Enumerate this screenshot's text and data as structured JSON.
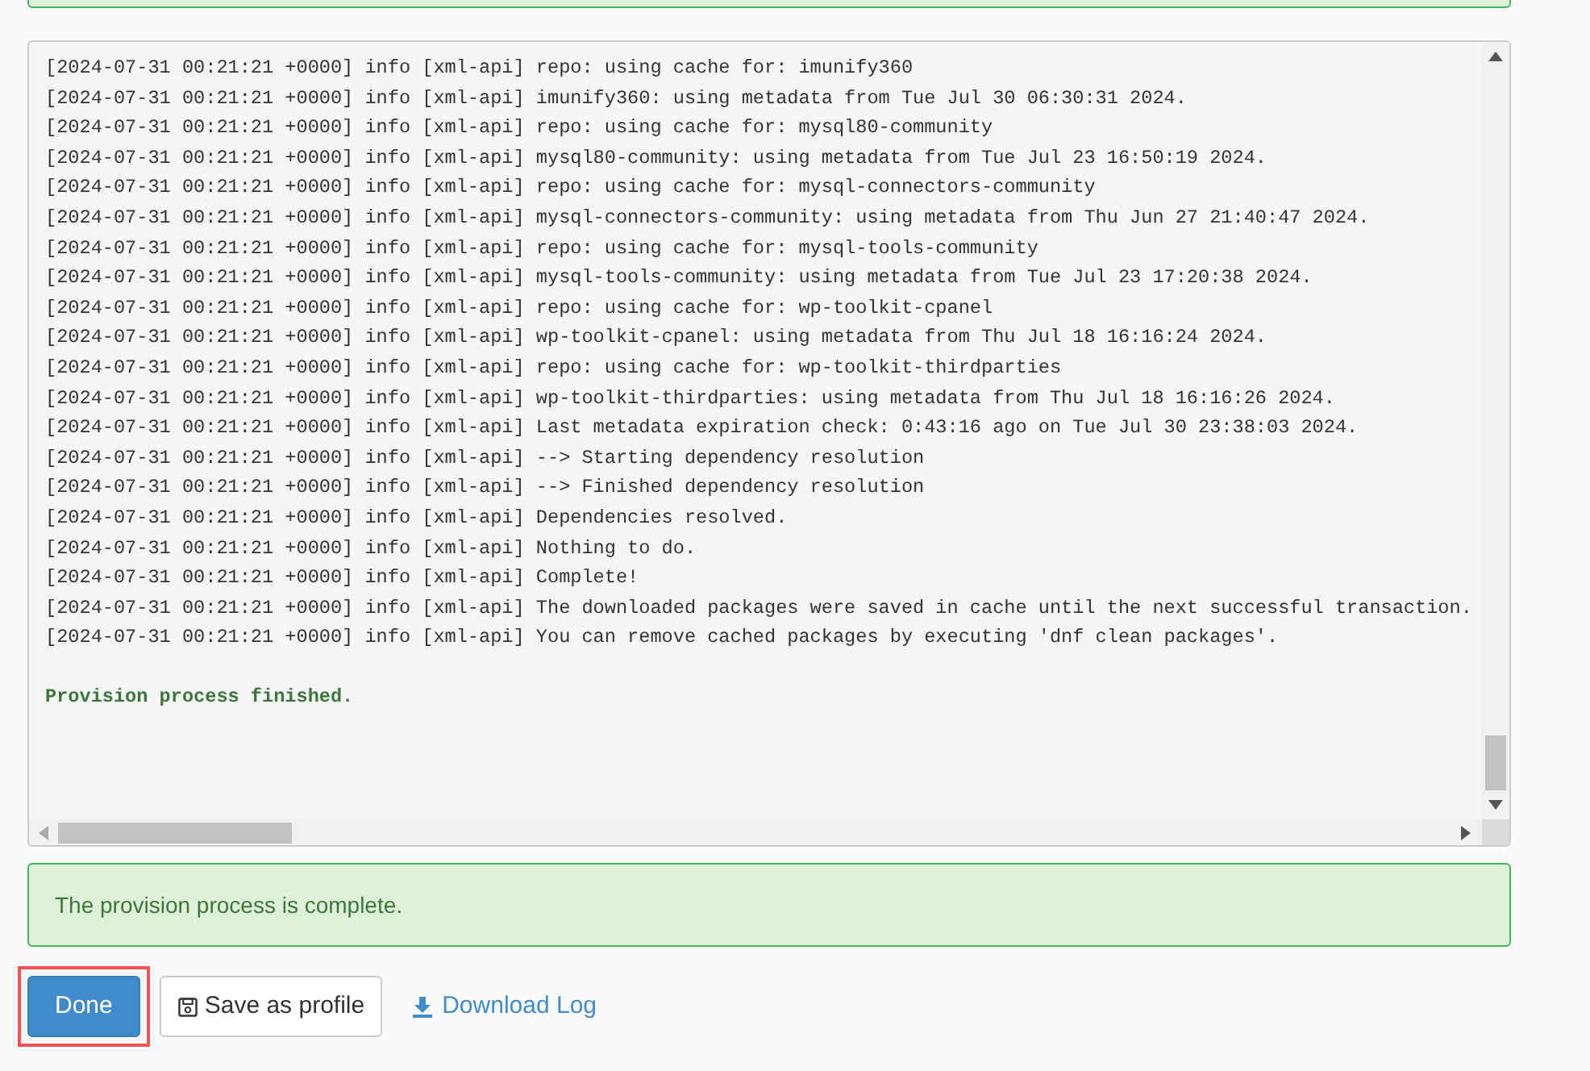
{
  "log": {
    "lines": [
      "[2024-07-31 00:21:21 +0000] info [xml-api] repo: using cache for: imunify360",
      "[2024-07-31 00:21:21 +0000] info [xml-api] imunify360: using metadata from Tue Jul 30 06:30:31 2024.",
      "[2024-07-31 00:21:21 +0000] info [xml-api] repo: using cache for: mysql80-community",
      "[2024-07-31 00:21:21 +0000] info [xml-api] mysql80-community: using metadata from Tue Jul 23 16:50:19 2024.",
      "[2024-07-31 00:21:21 +0000] info [xml-api] repo: using cache for: mysql-connectors-community",
      "[2024-07-31 00:21:21 +0000] info [xml-api] mysql-connectors-community: using metadata from Thu Jun 27 21:40:47 2024.",
      "[2024-07-31 00:21:21 +0000] info [xml-api] repo: using cache for: mysql-tools-community",
      "[2024-07-31 00:21:21 +0000] info [xml-api] mysql-tools-community: using metadata from Tue Jul 23 17:20:38 2024.",
      "[2024-07-31 00:21:21 +0000] info [xml-api] repo: using cache for: wp-toolkit-cpanel",
      "[2024-07-31 00:21:21 +0000] info [xml-api] wp-toolkit-cpanel: using metadata from Thu Jul 18 16:16:24 2024.",
      "[2024-07-31 00:21:21 +0000] info [xml-api] repo: using cache for: wp-toolkit-thirdparties",
      "[2024-07-31 00:21:21 +0000] info [xml-api] wp-toolkit-thirdparties: using metadata from Thu Jul 18 16:16:26 2024.",
      "[2024-07-31 00:21:21 +0000] info [xml-api] Last metadata expiration check: 0:43:16 ago on Tue Jul 30 23:38:03 2024.",
      "[2024-07-31 00:21:21 +0000] info [xml-api] --> Starting dependency resolution",
      "[2024-07-31 00:21:21 +0000] info [xml-api] --> Finished dependency resolution",
      "[2024-07-31 00:21:21 +0000] info [xml-api] Dependencies resolved.",
      "[2024-07-31 00:21:21 +0000] info [xml-api] Nothing to do.",
      "[2024-07-31 00:21:21 +0000] info [xml-api] Complete!",
      "[2024-07-31 00:21:21 +0000] info [xml-api] The downloaded packages were saved in cache until the next successful transaction.",
      "[2024-07-31 00:21:21 +0000] info [xml-api] You can remove cached packages by executing 'dnf clean packages'."
    ],
    "finished": "Provision process finished."
  },
  "alert": {
    "kind": "success",
    "text": "The provision process is complete."
  },
  "actions": [
    {
      "kind": "primary",
      "label": "Done",
      "highlighted": true
    },
    {
      "kind": "default",
      "label": "Save as profile",
      "highlighted": false
    },
    {
      "kind": "link",
      "label": "Download Log",
      "highlighted": false
    }
  ]
}
